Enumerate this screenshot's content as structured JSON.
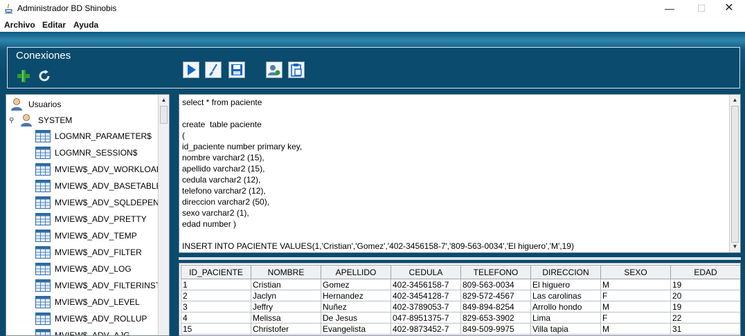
{
  "window": {
    "title": "Administrador BD Shinobis",
    "minimize": "—",
    "maximize": "☐",
    "close": "✕"
  },
  "menu": {
    "items": [
      "Archivo",
      "Editar",
      "Ayuda"
    ]
  },
  "connections": {
    "title": "Conexiones",
    "buttons": [
      "add-icon",
      "refresh-icon"
    ]
  },
  "toolbar": {
    "buttons": [
      "run-icon",
      "clear-brush-icon",
      "save-icon",
      "user-icon",
      "clipboard-icon"
    ]
  },
  "tree": {
    "root": "Usuarios",
    "schema": "SYSTEM",
    "tables": [
      "LOGMNR_PARAMETER$",
      "LOGMNR_SESSION$",
      "MVIEW$_ADV_WORKLOAD",
      "MVIEW$_ADV_BASETABLE",
      "MVIEW$_ADV_SQLDEPEND",
      "MVIEW$_ADV_PRETTY",
      "MVIEW$_ADV_TEMP",
      "MVIEW$_ADV_FILTER",
      "MVIEW$_ADV_LOG",
      "MVIEW$_ADV_FILTERINSTA",
      "MVIEW$_ADV_LEVEL",
      "MVIEW$_ADV_ROLLUP",
      "MVIEW$_ADV_AJG"
    ]
  },
  "editor": {
    "text": "select * from paciente\n\ncreate  table paciente\n(\nid_paciente number primary key,\nnombre varchar2 (15),\napellido varchar2 (15),\ncedula varchar2 (12),\ntelefono varchar2 (12),\ndireccion varchar2 (50),\nsexo varchar2 (1),\nedad number )\n\nINSERT INTO PACIENTE VALUES(1,'Cristian','Gomez','402-3456158-7','809-563-0034','El higuero','M',19)"
  },
  "results": {
    "columns": [
      "ID_PACIENTE",
      "NOMBRE",
      "APELLIDO",
      "CEDULA",
      "TELEFONO",
      "DIRECCION",
      "SEXO",
      "EDAD"
    ],
    "rows": [
      [
        "1",
        "Cristian",
        "Gomez",
        "402-3456158-7",
        "809-563-0034",
        "El higuero",
        "M",
        "19"
      ],
      [
        "2",
        "Jaclyn",
        "Hernandez",
        "402-3454128-7",
        "829-572-4567",
        "Las carolinas",
        "F",
        "20"
      ],
      [
        "3",
        "Jeffry",
        "Nuñez",
        "402-3789053-7",
        "849-894-8254",
        "Arrollo hondo",
        "M",
        "19"
      ],
      [
        "4",
        "Melissa",
        "De Jesus",
        "047-8951375-7",
        "829-653-3902",
        "Lima",
        "F",
        "22"
      ],
      [
        "15",
        "Christofer",
        "Evangelista",
        "402-9873452-7",
        "849-509-9975",
        "Villa tapia",
        "M",
        "31"
      ]
    ]
  },
  "colors": {
    "background": "#0a4a6c",
    "panel_border": "#d8e6ee",
    "accent_blue": "#1565c0"
  }
}
